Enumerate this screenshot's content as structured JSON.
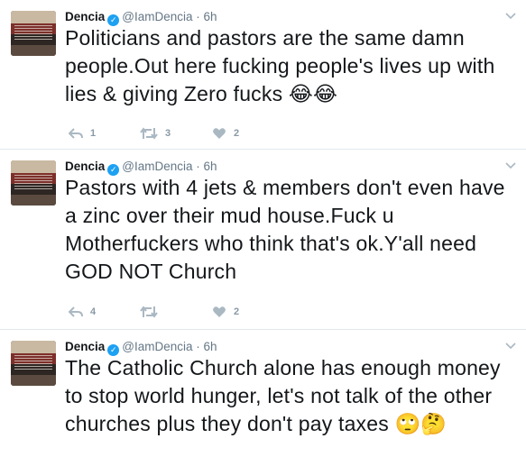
{
  "tweets": [
    {
      "name": "Dencia",
      "handle": "@IamDencia",
      "separator": "·",
      "time": "6h",
      "text": "Politicians and pastors are the same damn people.Out here fucking people's lives up with lies & giving Zero fucks ",
      "emoji": "😂😂",
      "replies": "1",
      "retweets": "3",
      "likes": "2"
    },
    {
      "name": "Dencia",
      "handle": "@IamDencia",
      "separator": "·",
      "time": "6h",
      "text": "Pastors with 4 jets & members don't even have a zinc over their mud house.Fuck u Motherfuckers who think that's ok.Y'all need GOD NOT Church",
      "emoji": "",
      "replies": "4",
      "retweets": "",
      "likes": "2"
    },
    {
      "name": "Dencia",
      "handle": "@IamDencia",
      "separator": "·",
      "time": "6h",
      "text": "The Catholic Church alone has enough money to stop world hunger, let's not talk of the other churches plus they don't pay taxes ",
      "emoji": "🙄🤔",
      "replies": "",
      "retweets": "",
      "likes": ""
    }
  ],
  "icons": {
    "verified": "verified-badge-icon",
    "caret": "chevron-down-icon",
    "reply": "reply-icon",
    "retweet": "retweet-icon",
    "like": "heart-icon"
  },
  "colors": {
    "verified": "#1da1f2",
    "icon_gray": "#aab8c2",
    "secondary_text": "#657786",
    "divider": "#e1e8ed"
  }
}
